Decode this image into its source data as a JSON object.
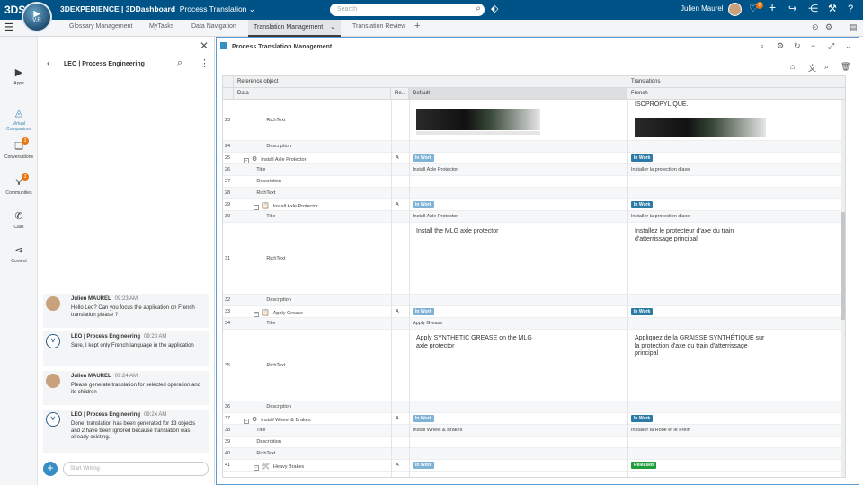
{
  "topbar": {
    "logo": "3DS",
    "compass_version": "V.R",
    "brand_prefix": "3DEXPERIENCE | ",
    "brand_app": "3DDashboard",
    "dashboard_name": "Process Translation",
    "search_placeholder": "Search",
    "user_name": "Julien Maurel",
    "notification_count": "2"
  },
  "tabs": [
    "Glossary Management",
    "MyTasks",
    "Data Navigation",
    "Translation Management",
    "Translation Review"
  ],
  "active_tab": "Translation Management",
  "leftnav": [
    {
      "label": "Apps",
      "icon": "apps-icon"
    },
    {
      "label": "Virtual Companions",
      "icon": "virtual-companion-icon"
    },
    {
      "label": "Conversations",
      "icon": "conversations-icon",
      "badge": "3"
    },
    {
      "label": "Communities",
      "icon": "communities-icon",
      "badge": "3"
    },
    {
      "label": "Calls",
      "icon": "phone-icon"
    },
    {
      "label": "Content",
      "icon": "share-icon"
    }
  ],
  "chat": {
    "title": "LEO | Process Engineering",
    "input_placeholder": "Start Writing",
    "messages": [
      {
        "sender": "Julien MAUREL",
        "time": "09:23 AM",
        "text": "Hello Leo? Can you focus the application on French translation please ?",
        "avatar": "julien"
      },
      {
        "sender": "LEO | Process Engineering",
        "time": "09:23 AM",
        "text": "Sure, I kept only French language in the application",
        "avatar": "leo"
      },
      {
        "sender": "Julien MAUREL",
        "time": "09:24 AM",
        "text": "Please generate translation for selected operation and its children",
        "avatar": "julien"
      },
      {
        "sender": "LEO | Process Engineering",
        "time": "09:24 AM",
        "text": "Done, translation has been generated for 13 objects and 2 have been ignored because translation was already existing.",
        "avatar": "leo"
      }
    ]
  },
  "panel": {
    "title": "Process Translation Management",
    "headers": {
      "reference_object": "Reference object",
      "translations": "Translations",
      "data": "Data",
      "re": "Re...",
      "default": "Default",
      "french": "French"
    }
  },
  "rows": [
    {
      "n": "23",
      "indent": 3,
      "label": "RichText",
      "re": "",
      "def": "",
      "fr": "ISOPROPYLIQUE.",
      "type": "image"
    },
    {
      "n": "24",
      "indent": 3,
      "label": "Description",
      "re": "",
      "def": "",
      "fr": ""
    },
    {
      "n": "25",
      "indent": 1,
      "label": "Install Axle Protector",
      "re": "A",
      "def_status": "In Work",
      "fr_status": "In Work",
      "exp": "−",
      "icon": "⚙"
    },
    {
      "n": "26",
      "indent": 2,
      "label": "Title",
      "re": "",
      "def": "Install Axle Protector",
      "fr": "Installer la protection d'axe"
    },
    {
      "n": "27",
      "indent": 2,
      "label": "Description",
      "re": "",
      "def": "",
      "fr": ""
    },
    {
      "n": "28",
      "indent": 2,
      "label": "RichText",
      "re": "",
      "def": "",
      "fr": ""
    },
    {
      "n": "29",
      "indent": 2,
      "label": "Install Axle Protector",
      "re": "A",
      "def_status": "In Work",
      "fr_status": "In Work",
      "exp": "−",
      "icon": "📋"
    },
    {
      "n": "30",
      "indent": 3,
      "label": "Title",
      "re": "",
      "def": "Install Axle Protector",
      "fr": "Installer la protection d'axe"
    },
    {
      "n": "31",
      "indent": 3,
      "label": "RichText",
      "re": "",
      "def": "Install the MLG axle protector",
      "fr": "Installez le protecteur d'axe du train d'atterrissage principal",
      "type": "big"
    },
    {
      "n": "32",
      "indent": 3,
      "label": "Description",
      "re": "",
      "def": "",
      "fr": ""
    },
    {
      "n": "33",
      "indent": 2,
      "label": "Apply Grease",
      "re": "A",
      "def_status": "In Work",
      "fr_status": "In Work",
      "exp": "−",
      "icon": "📋"
    },
    {
      "n": "34",
      "indent": 3,
      "label": "Title",
      "re": "",
      "def": "Apply Grease",
      "fr": ""
    },
    {
      "n": "35",
      "indent": 3,
      "label": "RichText",
      "re": "",
      "def": "Apply SYNTHETIC GREASE on the MLG axle protector",
      "fr": "Appliquez de la GRAISSE SYNTHÉTIQUE sur la protection d'axe du train d'atterrissage principal",
      "type": "big"
    },
    {
      "n": "36",
      "indent": 3,
      "label": "Description",
      "re": "",
      "def": "",
      "fr": ""
    },
    {
      "n": "37",
      "indent": 1,
      "label": "Install Wheel & Brakes",
      "re": "A",
      "def_status": "In Work",
      "fr_status": "In Work",
      "exp": "−",
      "icon": "⚙"
    },
    {
      "n": "38",
      "indent": 2,
      "label": "Title",
      "re": "",
      "def": "Install Wheel & Brakes",
      "fr": "Installer la Roue et le Frein"
    },
    {
      "n": "39",
      "indent": 2,
      "label": "Description",
      "re": "",
      "def": "",
      "fr": ""
    },
    {
      "n": "40",
      "indent": 2,
      "label": "RichText",
      "re": "",
      "def": "",
      "fr": ""
    },
    {
      "n": "41",
      "indent": 2,
      "label": "Heavy Brakes",
      "re": "A",
      "def_status": "In Work",
      "fr_status": "Released",
      "exp": "−",
      "icon": "🛠"
    }
  ]
}
